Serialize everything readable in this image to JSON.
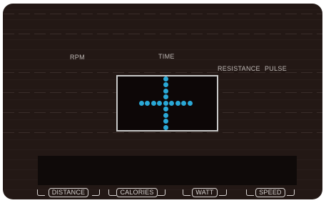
{
  "labels": {
    "rpm": "RPM",
    "time": "TIME",
    "resistance": "RESISTANCE",
    "pulse": "PULSE"
  },
  "display": {
    "symbol": "plus-sign",
    "dot_color": "#2aa8d6",
    "frame_color": "#c8c8c8"
  },
  "buttons": {
    "distance": "DISTANCE",
    "calories": "CALORIES",
    "watt": "WATT",
    "speed": "SPEED"
  },
  "colors": {
    "console_bg": "#231815",
    "text": "#bfb9b6"
  }
}
